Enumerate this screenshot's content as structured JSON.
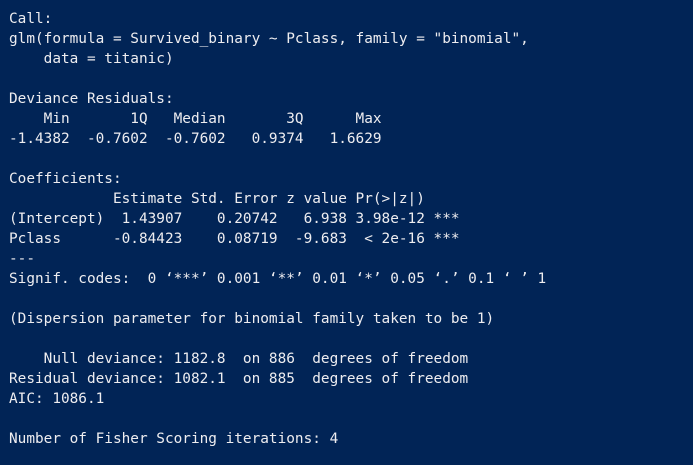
{
  "console": {
    "background": "#012456",
    "foreground": "#eeedf0",
    "lines": [
      "Call:",
      "glm(formula = Survived_binary ~ Pclass, family = \"binomial\",",
      "    data = titanic)",
      "",
      "Deviance Residuals:",
      "    Min       1Q   Median       3Q      Max",
      "-1.4382  -0.7602  -0.7602   0.9374   1.6629",
      "",
      "Coefficients:",
      "            Estimate Std. Error z value Pr(>|z|)",
      "(Intercept)  1.43907    0.20742   6.938 3.98e-12 ***",
      "Pclass      -0.84423    0.08719  -9.683  < 2e-16 ***",
      "---",
      "Signif. codes:  0 ‘***’ 0.001 ‘**’ 0.01 ‘*’ 0.05 ‘.’ 0.1 ‘ ’ 1",
      "",
      "(Dispersion parameter for binomial family taken to be 1)",
      "",
      "    Null deviance: 1182.8  on 886  degrees of freedom",
      "Residual deviance: 1082.1  on 885  degrees of freedom",
      "AIC: 1086.1",
      "",
      "Number of Fisher Scoring iterations: 4"
    ]
  }
}
